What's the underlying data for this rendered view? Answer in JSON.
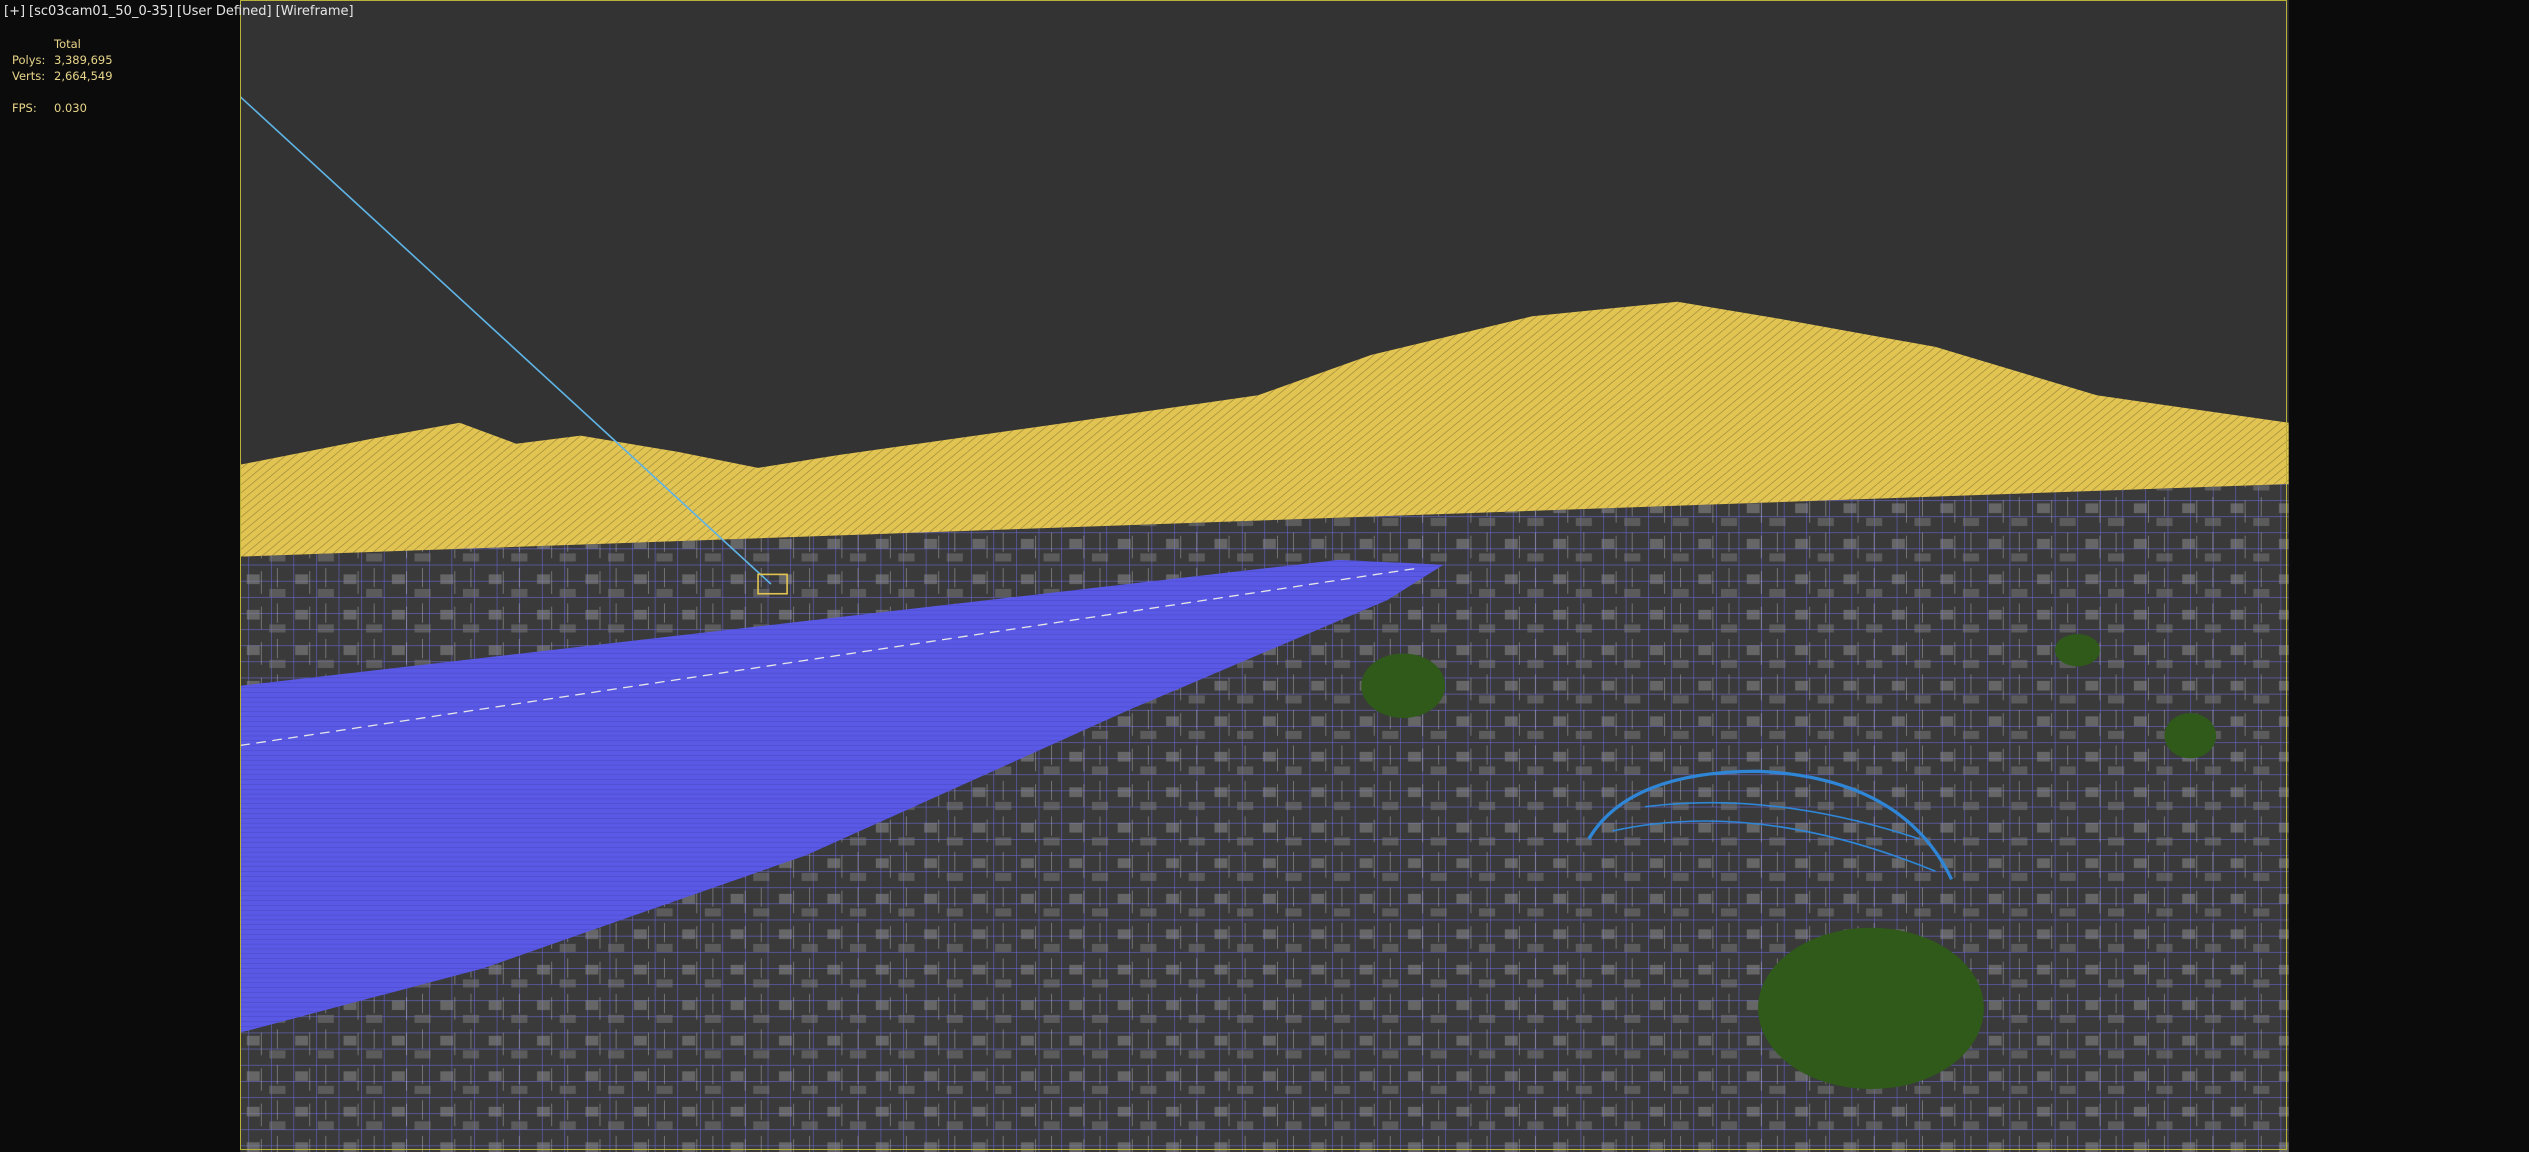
{
  "viewport": {
    "label_parts": [
      "[+]",
      "[sc03cam01_50_0-35]",
      "[User Defined]",
      "[Wireframe]"
    ],
    "border_color": "#b9b23a",
    "background": "#333333"
  },
  "stats": {
    "header": "Total",
    "rows": [
      {
        "key": "Polys:",
        "value": "3,389,695"
      },
      {
        "key": "Verts:",
        "value": "2,664,549"
      }
    ],
    "fps_key": "FPS:",
    "fps_value": "0.030"
  },
  "colors": {
    "mountains": "#e2c453",
    "river": "#5a59e6",
    "ground_grid": "#6e6ce0",
    "vegetation": "#2f5a1a",
    "dome": "#2f86d6"
  }
}
